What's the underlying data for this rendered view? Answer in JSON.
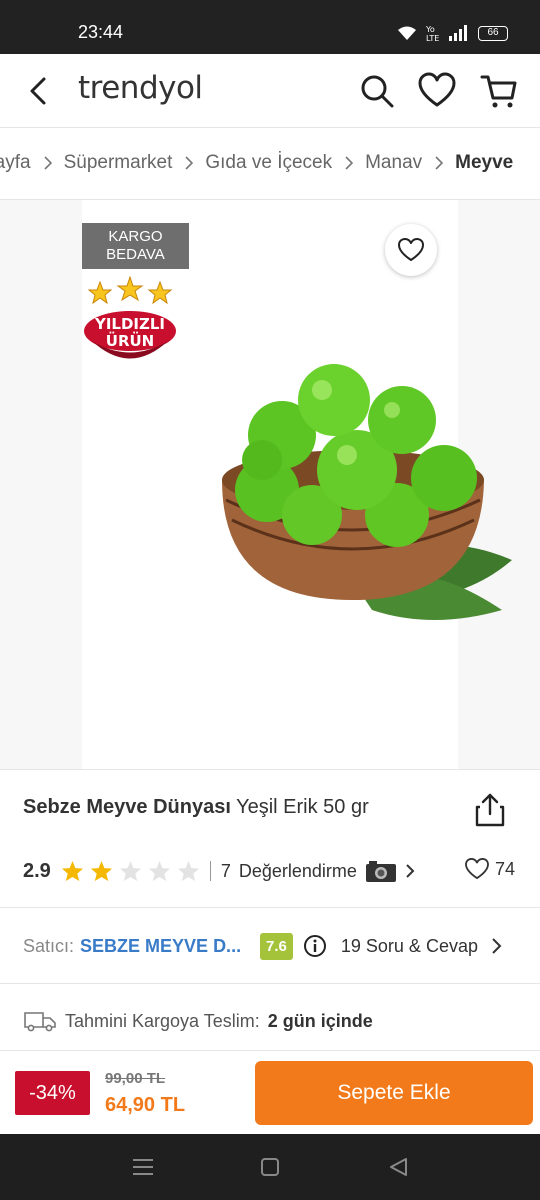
{
  "status": {
    "time": "23:44",
    "battery": "66"
  },
  "header": {
    "logo": "trendyol"
  },
  "breadcrumb": [
    "Sayfa",
    "Süpermarket",
    "Gıda ve İçecek",
    "Manav",
    "Meyve"
  ],
  "image_badges": {
    "kargo_line1": "KARGO",
    "kargo_line2": "BEDAVA",
    "star_line1": "YILDIZLI",
    "star_line2": "ÜRÜN"
  },
  "product": {
    "brand": "Sebze Meyve Dünyası",
    "name": "Yeşil Erik 50 gr",
    "rating": "2.9",
    "rating_value": 2.9,
    "review_count": "7",
    "review_label": "Değerlendirme",
    "favorites": "74"
  },
  "seller": {
    "label": "Satıcı:",
    "name": "SEBZE MEYVE D...",
    "score": "7.6",
    "qa": "19 Soru & Cevap"
  },
  "delivery": {
    "label": "Tahmini Kargoya Teslim:",
    "value": "2 gün içinde"
  },
  "price": {
    "discount": "-34%",
    "old": "99,00 TL",
    "new": "64,90 TL"
  },
  "cta": {
    "add_to_cart": "Sepete Ekle"
  },
  "colors": {
    "brand_orange": "#f27a1a",
    "discount_red": "#c8102e",
    "seller_blue": "#3a7bc8",
    "score_green": "#a5c33a",
    "star_yellow": "#f5b800"
  }
}
